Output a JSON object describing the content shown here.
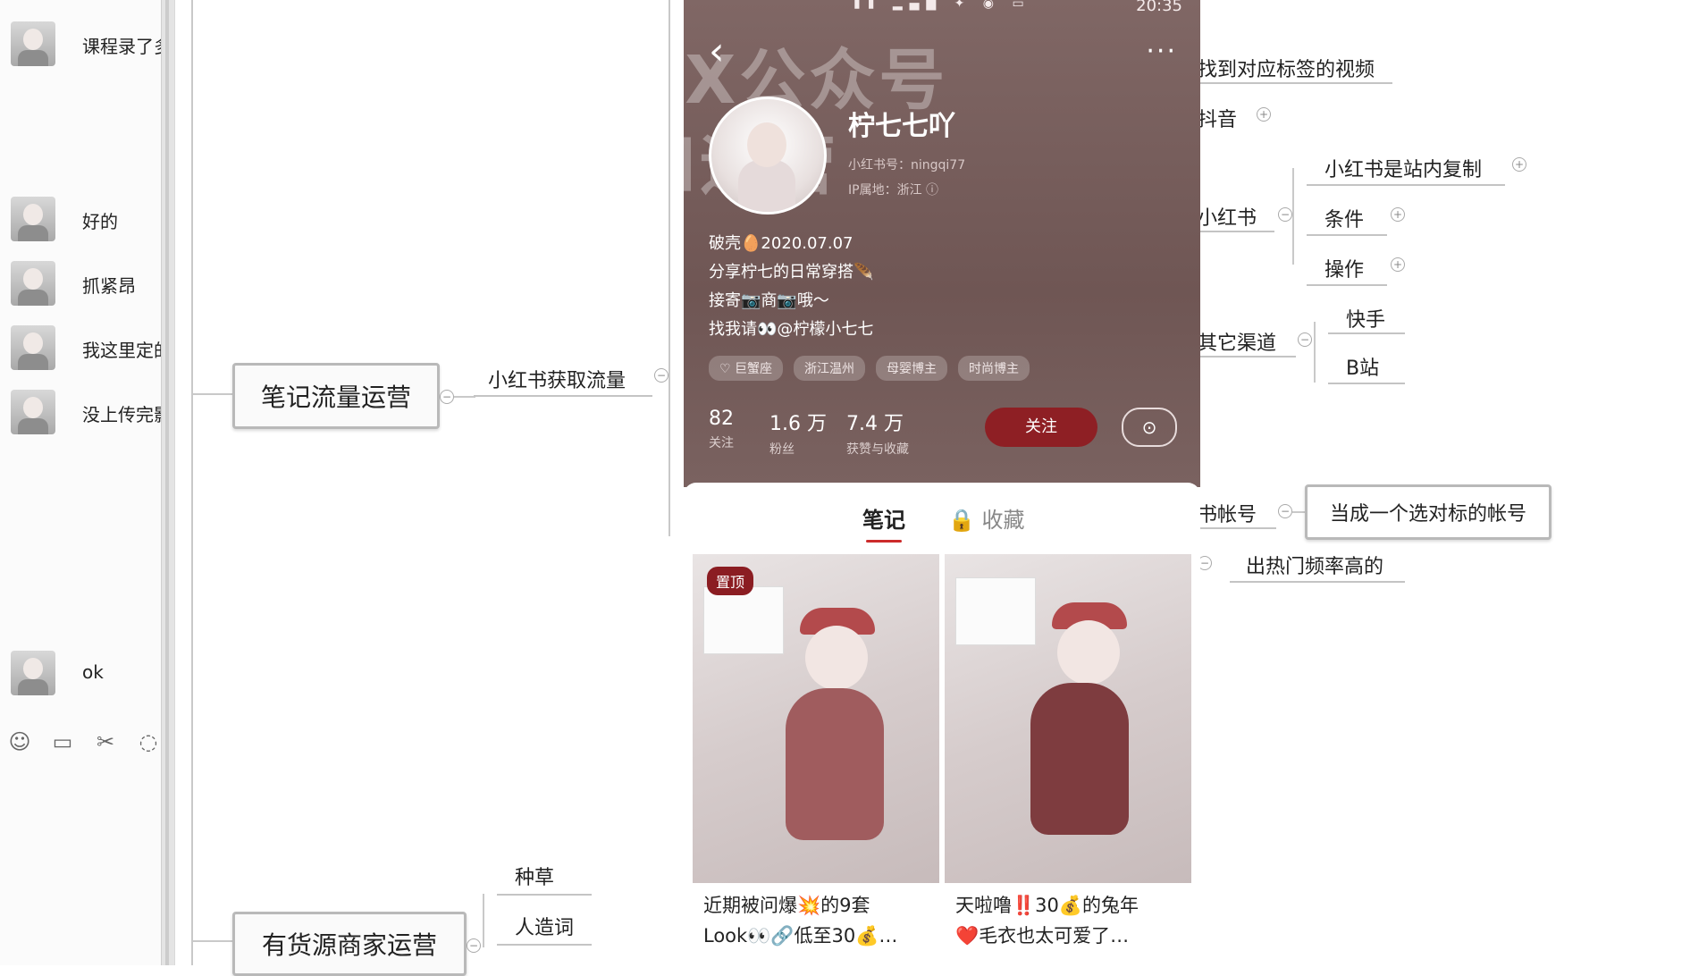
{
  "chat": {
    "messages": [
      {
        "text": "课程录了多"
      },
      {
        "text": "好的"
      },
      {
        "text": "抓紧昂"
      },
      {
        "text": "我这里定的"
      },
      {
        "text": "没上传完影"
      },
      {
        "text": "ok"
      }
    ],
    "tools": [
      "emoji-icon",
      "folder-icon",
      "scissors-icon",
      "chat-bubble-icon"
    ]
  },
  "mindmap": {
    "root1": "笔记流量运营",
    "child1": "小红书获取流量",
    "root2": "有货源商家运营",
    "root2_children": [
      "种草",
      "人造词"
    ],
    "right": {
      "find_video": "找到对应标签的视频",
      "douyin": "抖音",
      "xhs": "小红书",
      "xhs_children": [
        "小红书是站内复制",
        "条件",
        "操作"
      ],
      "other_channels": "其它渠道",
      "other_children": [
        "快手",
        "B站"
      ],
      "account": "书帐号",
      "account_child": "当成一个选对标的帐号",
      "hot": "出热门频率高的"
    }
  },
  "phone": {
    "status_time": "20:35",
    "watermark_line1": "VX公众号",
    "watermark_line2": "和运营",
    "username": "柠七七吖",
    "redid": "小红书号：ningqi77",
    "ip": "IP属地：浙江 ⓘ",
    "bio": [
      "破壳🥚2020.07.07",
      "分享柠七的日常穿搭🪶",
      "接寄📷商📷哦～",
      "找我请👀@柠檬小七七"
    ],
    "tags": [
      "♡ 巨蟹座",
      "浙江温州",
      "母婴博主",
      "时尚博主"
    ],
    "stats": [
      {
        "n": "82",
        "l": "关注"
      },
      {
        "n": "1.6 万",
        "l": "粉丝"
      },
      {
        "n": "7.4 万",
        "l": "获赞与收藏"
      }
    ],
    "follow": "关注",
    "tabs": {
      "notes": "笔记",
      "fav": "🔒 收藏"
    },
    "cards": [
      {
        "pin": "置顶",
        "title1": "近期被问爆💥的9套",
        "title2": "Look👀🔗低至30💰…"
      },
      {
        "title1": "天啦噜‼️30💰的兔年",
        "title2": "❤️毛衣也太可爱了…"
      }
    ]
  }
}
